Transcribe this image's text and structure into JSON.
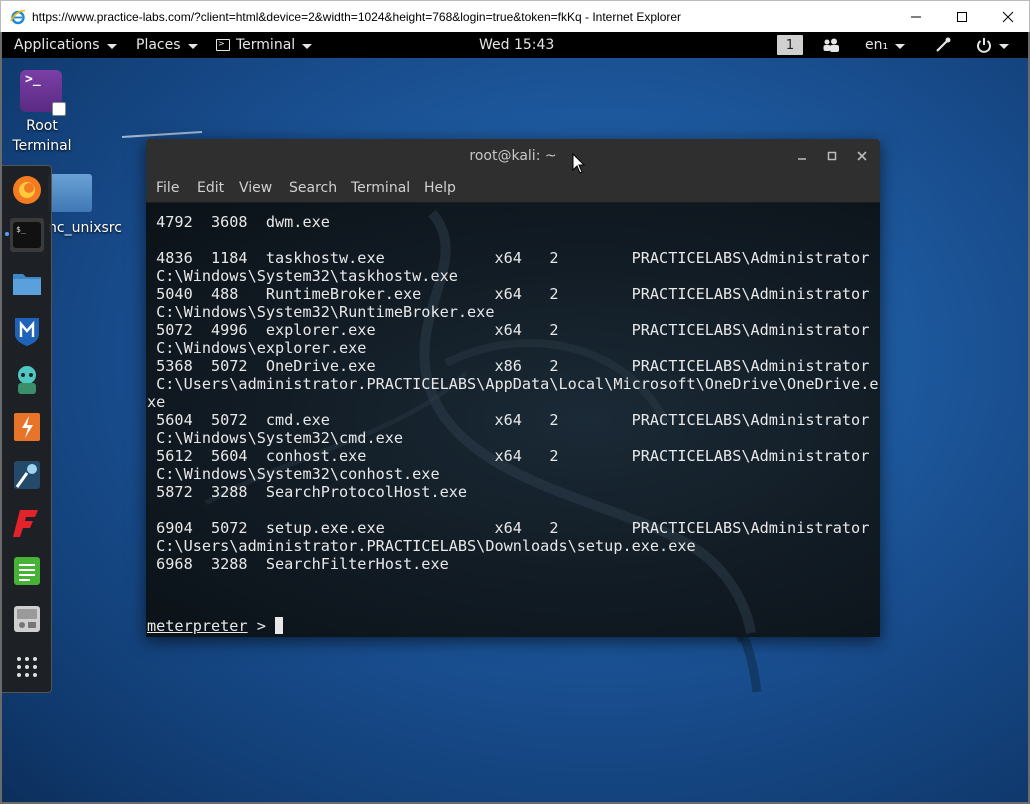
{
  "browser": {
    "title": "https://www.practice-labs.com/?client=html&device=2&width=1024&height=768&login=true&token=fkKq - Internet Explorer"
  },
  "topbar": {
    "applications": "Applications",
    "places": "Places",
    "terminal": "Terminal",
    "clock": "Wed 15:43",
    "workspace": "1",
    "language": "en₁"
  },
  "desktop": {
    "root_terminal_label_1": "Root",
    "root_terminal_label_2": "Terminal",
    "folder_label": "nc_unixsrc"
  },
  "dock": {
    "items": [
      "firefox",
      "terminal",
      "files",
      "metasploit",
      "armitage",
      "burpsuite",
      "maltego",
      "faraday",
      "leafpad",
      "screenshot",
      "show-apps"
    ]
  },
  "terminal": {
    "title": "root@kali: ~",
    "menu": [
      "File",
      "Edit",
      "View",
      "Search",
      "Terminal",
      "Help"
    ],
    "lines": [
      " 4792  3608  dwm.exe",
      "",
      " 4836  1184  taskhostw.exe            x64   2        PRACTICELABS\\Administrator",
      " C:\\Windows\\System32\\taskhostw.exe",
      " 5040  488   RuntimeBroker.exe        x64   2        PRACTICELABS\\Administrator",
      " C:\\Windows\\System32\\RuntimeBroker.exe",
      " 5072  4996  explorer.exe             x64   2        PRACTICELABS\\Administrator",
      " C:\\Windows\\explorer.exe",
      " 5368  5072  OneDrive.exe             x86   2        PRACTICELABS\\Administrator",
      " C:\\Users\\administrator.PRACTICELABS\\AppData\\Local\\Microsoft\\OneDrive\\OneDrive.e",
      "xe",
      " 5604  5072  cmd.exe                  x64   2        PRACTICELABS\\Administrator",
      " C:\\Windows\\System32\\cmd.exe",
      " 5612  5604  conhost.exe              x64   2        PRACTICELABS\\Administrator",
      " C:\\Windows\\System32\\conhost.exe",
      " 5872  3288  SearchProtocolHost.exe",
      "",
      " 6904  5072  setup.exe.exe            x64   2        PRACTICELABS\\Administrator",
      " C:\\Users\\administrator.PRACTICELABS\\Downloads\\setup.exe.exe",
      " 6968  3288  SearchFilterHost.exe"
    ],
    "prompt": "meterpreter",
    "prompt_suffix": " > "
  },
  "colors": {
    "desktop_blue": "#1f5da3",
    "terminal_bg": "#121c25",
    "titlebar": "#2f2f2f"
  }
}
